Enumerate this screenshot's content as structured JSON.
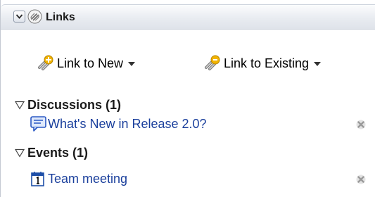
{
  "panel": {
    "title": "Links",
    "collapse_icon": "chevron-down-icon",
    "header_icon": "link-icon"
  },
  "toolbar": {
    "link_new_label": "Link to New",
    "link_existing_label": "Link to Existing"
  },
  "sections": [
    {
      "title": "Discussions (1)",
      "items": [
        {
          "label": "What's New in Release 2.0?",
          "icon": "discussion-icon"
        }
      ]
    },
    {
      "title": "Events (1)",
      "items": [
        {
          "label": "Team meeting",
          "icon": "calendar-icon"
        }
      ]
    }
  ],
  "colors": {
    "link": "#1a3f9c",
    "header_bg": "#e9ecf1"
  }
}
